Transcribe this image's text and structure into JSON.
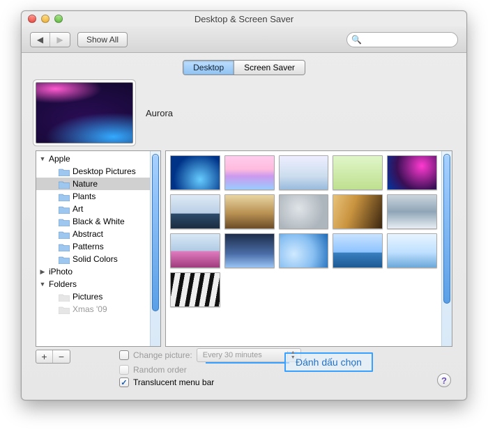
{
  "window": {
    "title": "Desktop & Screen Saver"
  },
  "toolbar": {
    "show_all_label": "Show All",
    "search_placeholder": ""
  },
  "tabs": {
    "desktop": "Desktop",
    "screensaver": "Screen Saver",
    "active": "desktop"
  },
  "wallpaper": {
    "current_name": "Aurora"
  },
  "sidebar": {
    "groups": [
      {
        "label": "Apple",
        "expanded": true,
        "items": [
          {
            "label": "Desktop Pictures"
          },
          {
            "label": "Nature",
            "selected": true
          },
          {
            "label": "Plants"
          },
          {
            "label": "Art"
          },
          {
            "label": "Black & White"
          },
          {
            "label": "Abstract"
          },
          {
            "label": "Patterns"
          },
          {
            "label": "Solid Colors"
          }
        ]
      },
      {
        "label": "iPhoto",
        "expanded": false,
        "items": []
      },
      {
        "label": "Folders",
        "expanded": true,
        "items": [
          {
            "label": "Pictures",
            "ghost": true
          },
          {
            "label": "Xmas '09",
            "ghost": true,
            "cutoff": true
          }
        ]
      }
    ]
  },
  "thumbnails": {
    "count": 16,
    "styles": [
      "radial-gradient(circle at 60% 70%, #6cf, #038 70%)",
      "linear-gradient(#fce,#fbd 40%,#c9e 60%,#9cf)",
      "linear-gradient(#eef,#cde 60%,#9bd)",
      "linear-gradient(#e0f6c9,#bfe08f)",
      "radial-gradient(circle at 70% 30%,#ff3ad1,#3a0f55 60%,#0036a0)",
      "linear-gradient(#dfeaf5,#b9cee6 55%,#2c4b6b 56%,#1b2d40)",
      "linear-gradient(#e9d5a3,#b89052 55%,#6b4c27)",
      "radial-gradient(circle at 40% 40%,#dfe4e8,#aeb6bd 70%)",
      "linear-gradient(110deg,#e8c27a,#c9933f 40%,#3b2610)",
      "linear-gradient(#cbd5dd,#8fa5b7 50%,#e8eef3)",
      "linear-gradient(#d9e8f5,#b0cbe5 50%,#e07bbf 52%,#a03b7e)",
      "linear-gradient(#1e2d4a,#4b6ea8 60%,#99c3f5)",
      "radial-gradient(circle at 30% 60%,#cfe9ff,#88bff2 50%,#1e6bb8)",
      "linear-gradient(#c9e3ff,#8cc3ff 55%,#3a7fbf 56%,#1d5a94)",
      "linear-gradient(#e8f4ff,#bfe0ff 55%,#6aa8da)",
      "repeating-linear-gradient(100deg,#111 0 6px,#eee 6px 14px)"
    ]
  },
  "options": {
    "change_picture": {
      "label": "Change picture:",
      "checked": false,
      "interval": "Every 30 minutes"
    },
    "random_order": {
      "label": "Random order",
      "checked": false,
      "enabled": false
    },
    "translucent_bar": {
      "label": "Translucent menu bar",
      "checked": true
    }
  },
  "annotation": {
    "text": "Đánh dấu chọn"
  }
}
